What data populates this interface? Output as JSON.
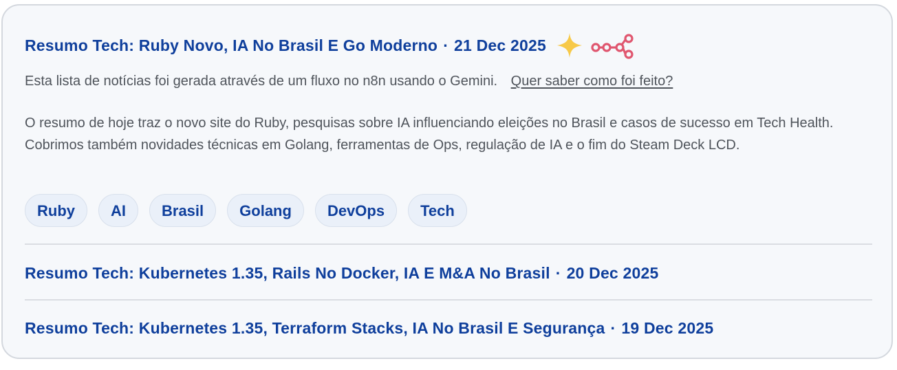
{
  "featured": {
    "title": "Resumo Tech: Ruby Novo, IA No Brasil E Go Moderno",
    "separator": "·",
    "date": "21 Dec 2025",
    "icons": [
      "sparkle-icon",
      "n8n-workflow-icon"
    ],
    "intro": "Esta lista de notícias foi gerada através de um fluxo no n8n usando o Gemini.",
    "how_link": "Quer saber como foi feito?",
    "summary": "O resumo de hoje traz o novo site do Ruby, pesquisas sobre IA influenciando eleições no Brasil e casos de sucesso em Tech Health. Cobrimos também novidades técnicas em Golang, ferramentas de Ops, regulação de IA e o fim do Steam Deck LCD.",
    "tags": [
      "Ruby",
      "AI",
      "Brasil",
      "Golang",
      "DevOps",
      "Tech"
    ]
  },
  "items": [
    {
      "title": "Resumo Tech: Kubernetes 1.35, Rails No Docker, IA E M&A No Brasil",
      "separator": "·",
      "date": "20 Dec 2025"
    },
    {
      "title": "Resumo Tech: Kubernetes 1.35, Terraform Stacks, IA No Brasil E Segurança",
      "separator": "·",
      "date": "19 Dec 2025"
    }
  ],
  "colors": {
    "link": "#0f3f9c",
    "text": "#4f545b",
    "sparkle": "#f7c948",
    "n8n": "#e0566f",
    "card_bg": "#f6f8fb",
    "tag_bg": "#eaf0f9"
  }
}
